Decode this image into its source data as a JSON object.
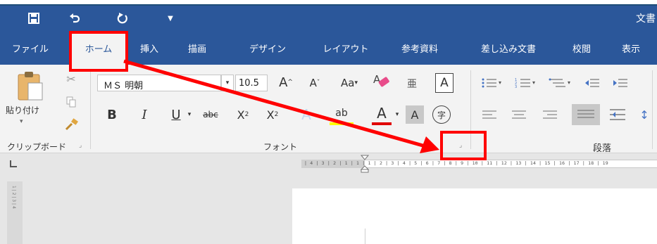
{
  "title_bar": {
    "doc_title": "文書"
  },
  "tabs": [
    {
      "label": "ファイル"
    },
    {
      "label": "ホーム"
    },
    {
      "label": "挿入"
    },
    {
      "label": "描画"
    },
    {
      "label": "デザイン"
    },
    {
      "label": "レイアウト"
    },
    {
      "label": "参考資料"
    },
    {
      "label": "差し込み文書"
    },
    {
      "label": "校閲"
    },
    {
      "label": "表示"
    }
  ],
  "ribbon": {
    "clipboard": {
      "paste_label": "貼り付け",
      "group_label": "クリップボード"
    },
    "font": {
      "font_name": "ＭＳ 明朝",
      "font_size": "10.5",
      "group_label": "フォント",
      "grow_glyph": "A",
      "shrink_glyph": "A",
      "case_glyph": "Aa",
      "phonetic_glyph": "亜",
      "border_glyph": "A",
      "bold_glyph": "B",
      "italic_glyph": "I",
      "underline_glyph": "U",
      "strike_glyph": "abc",
      "subscript_glyph": "X",
      "superscript_glyph": "X",
      "subscript_index": "2",
      "superscript_index": "2",
      "effects_glyph": "A",
      "highlight_glyph": "ab",
      "color_glyph": "A",
      "shading_glyph": "A",
      "enclose_glyph": "字"
    },
    "paragraph": {
      "group_label": "段落"
    }
  },
  "ruler": {
    "scale_text": "| 4 | 3 | 2 | 1 | 1   | 1 | 2 | 3 | 4 | 5 | 6 | 7 | 8 | 9 | 10 | 11 | 12 | 13 | 14 | 15 | 16 | 17 | 18 | 19",
    "vertical_text": "1 | 2 | 3 | 4"
  },
  "annotation": {
    "color": "#ff0000"
  },
  "colors": {
    "title_bar": "#2b579a",
    "ribbon": "#f3f3f3",
    "font_color_underline": "#e00000",
    "highlight_underline": "#ffff00"
  }
}
